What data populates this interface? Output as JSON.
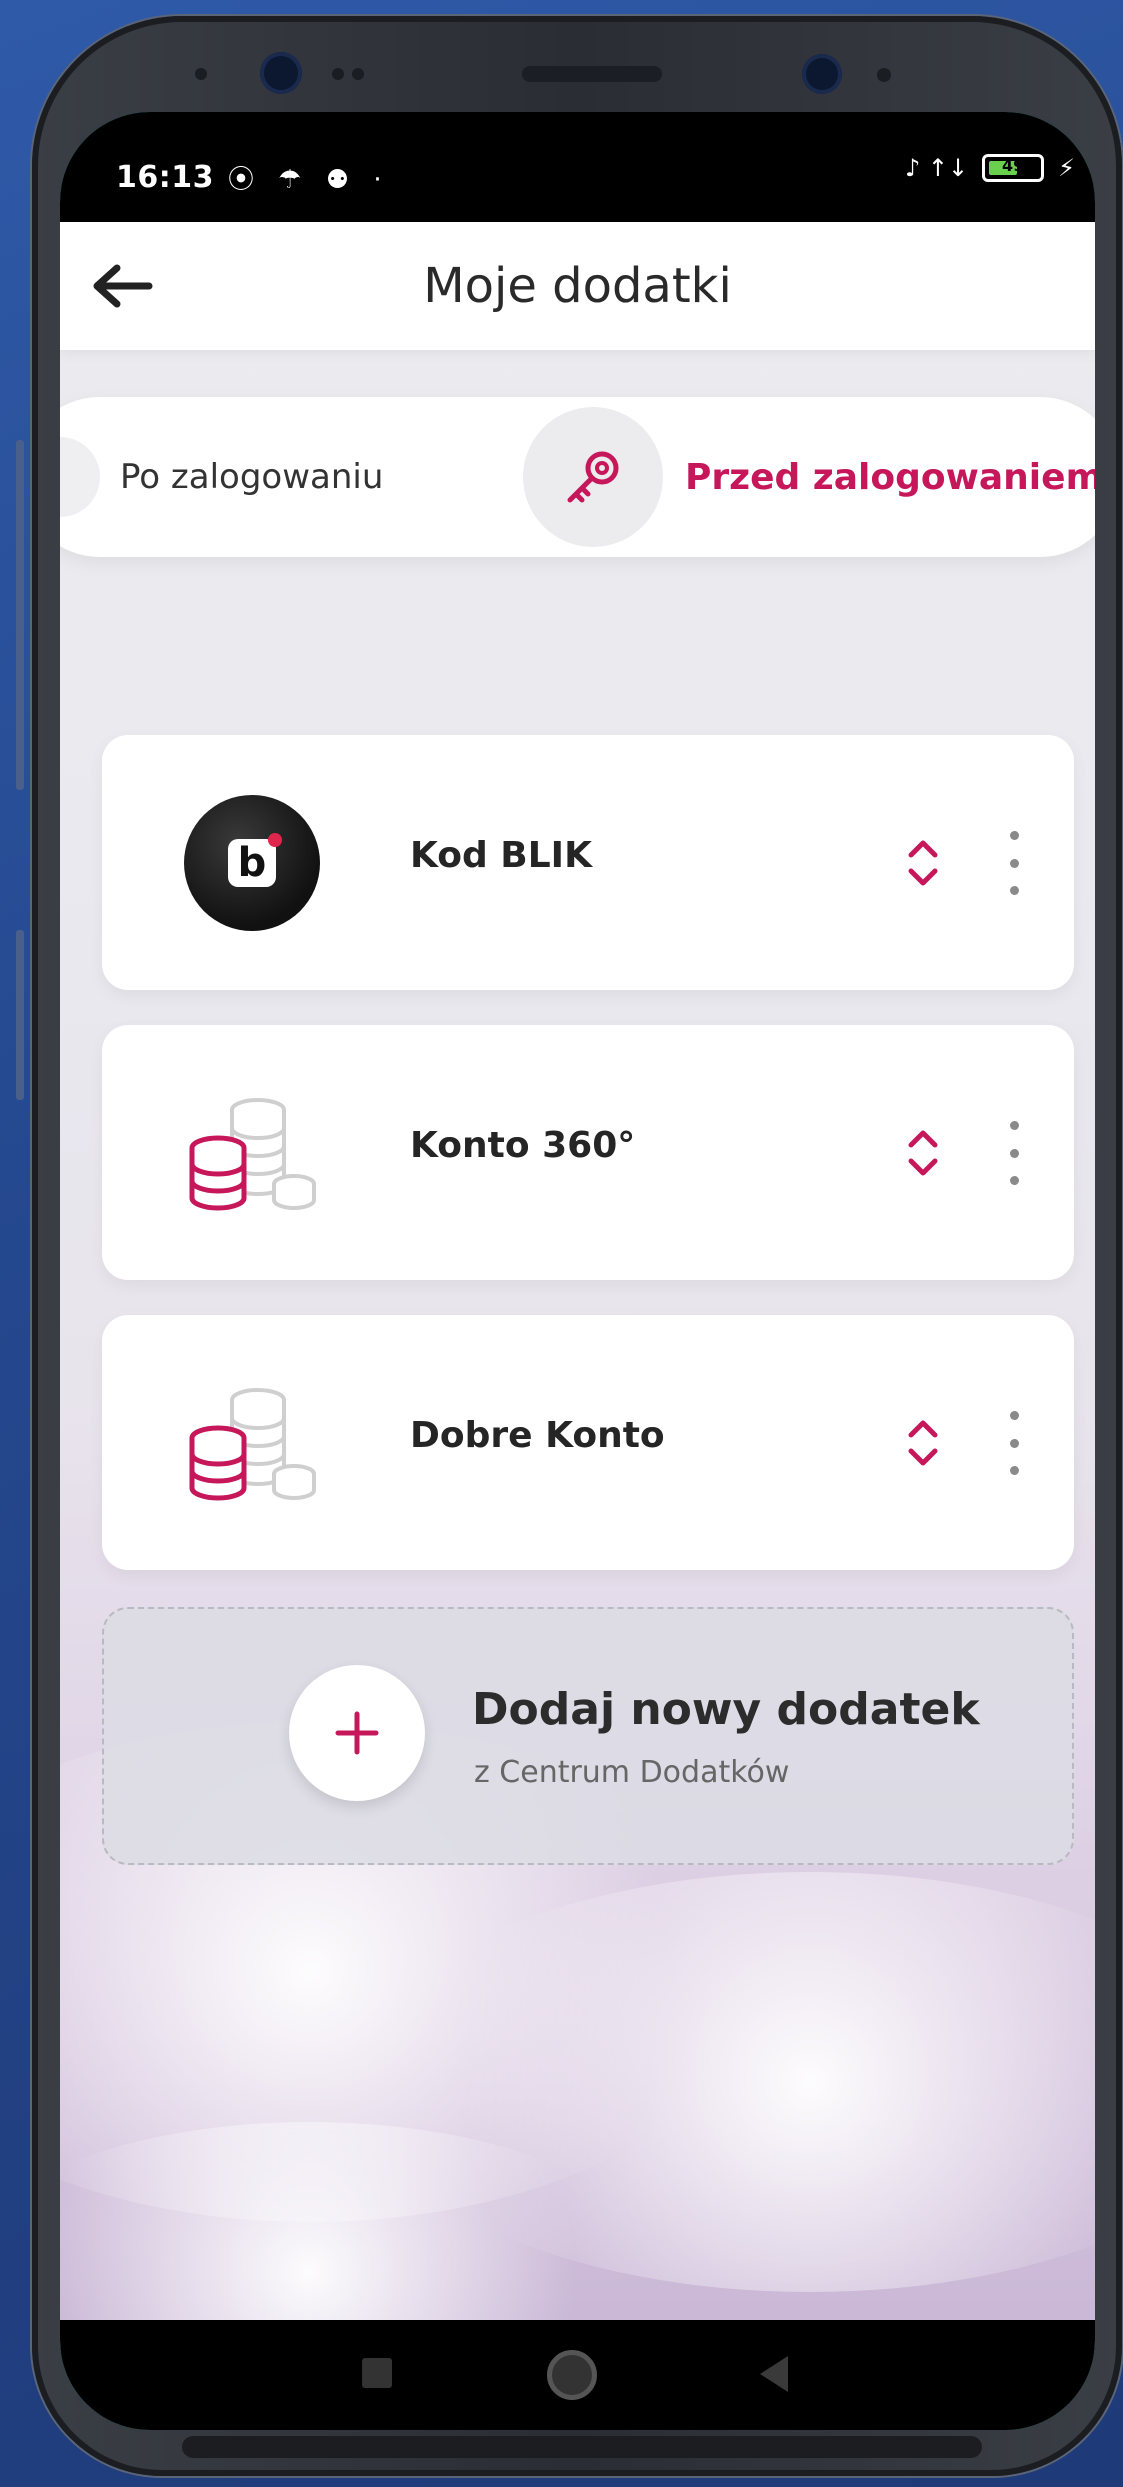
{
  "status_bar": {
    "time": "16:13",
    "left_icons": "⦿ ☂ ⚉ ·",
    "right_icons": "♪ ↑↓",
    "battery_level": "49"
  },
  "header": {
    "title": "Moje dodatki"
  },
  "tabs": {
    "left_label": "Po zalogowaniu",
    "right_label": "Przed zalogowaniem"
  },
  "addons": [
    {
      "label": "Kod BLIK",
      "icon": "blik-logo-icon"
    },
    {
      "label": "Konto 360°",
      "icon": "coins-icon"
    },
    {
      "label": "Dobre Konto",
      "icon": "coins-icon"
    }
  ],
  "add_new": {
    "title": "Dodaj nowy dodatek",
    "subtitle": "z Centrum Dodatków"
  },
  "colors": {
    "accent": "#c6175a",
    "battery": "#6ad14f"
  }
}
